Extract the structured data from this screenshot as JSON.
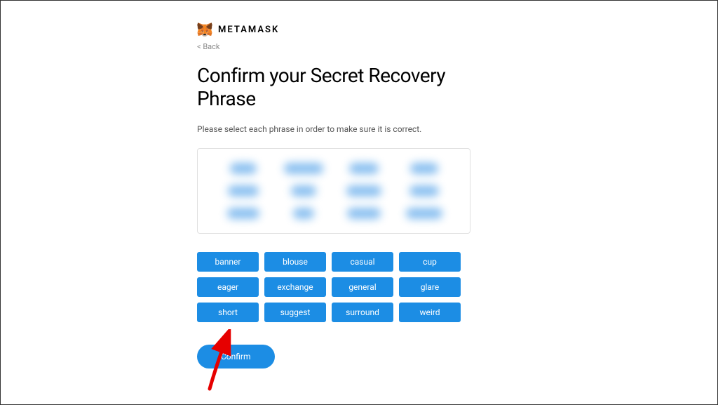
{
  "brand": {
    "name": "METAMASK"
  },
  "nav": {
    "back_label": "< Back"
  },
  "page": {
    "title": "Confirm your Secret Recovery Phrase",
    "instruction": "Please select each phrase in order to make sure it is correct."
  },
  "blurred_placeholder_widths": [
    38,
    56,
    42,
    40,
    44,
    36,
    50,
    42,
    46,
    30,
    48,
    52
  ],
  "words": [
    "banner",
    "blouse",
    "casual",
    "cup",
    "eager",
    "exchange",
    "general",
    "glare",
    "short",
    "suggest",
    "surround",
    "weird"
  ],
  "actions": {
    "confirm_label": "Confirm"
  },
  "colors": {
    "accent": "#1c8de4"
  }
}
